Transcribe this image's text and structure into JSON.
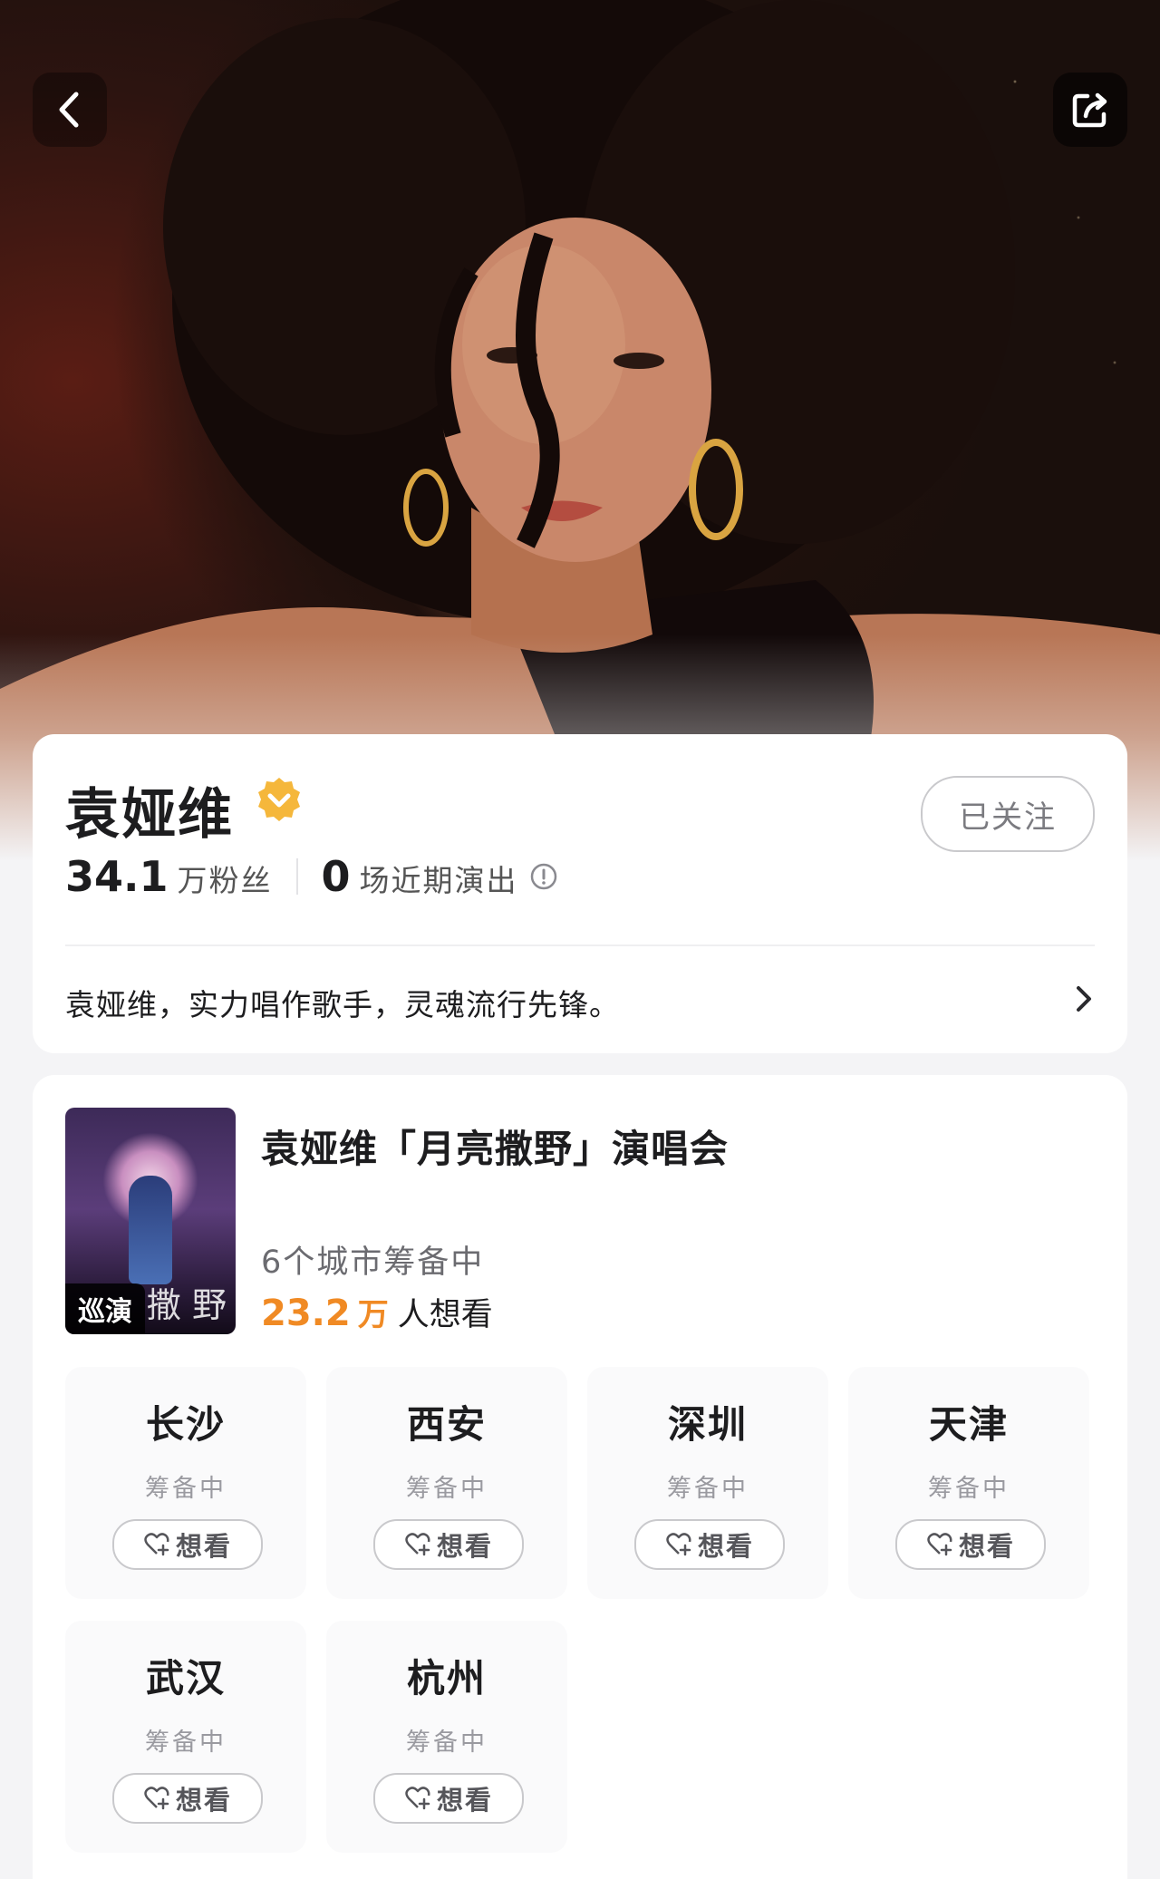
{
  "artist": {
    "name": "袁娅维",
    "followers_num": "34.1",
    "followers_label": "万粉丝",
    "shows_num": "0",
    "shows_label": "场近期演出",
    "follow_button": "已关注",
    "intro": "袁娅维，实力唱作歌手，灵魂流行先锋。"
  },
  "tour": {
    "poster_tag": "巡演",
    "poster_art_text": "撒 野",
    "title": "袁娅维「月亮撒野」演唱会",
    "status": "6个城市筹备中",
    "want_num": "23.2",
    "want_unit": "万",
    "want_label": "人想看",
    "cities": [
      {
        "name": "长沙",
        "status": "筹备中",
        "button": "想看"
      },
      {
        "name": "西安",
        "status": "筹备中",
        "button": "想看"
      },
      {
        "name": "深圳",
        "status": "筹备中",
        "button": "想看"
      },
      {
        "name": "天津",
        "status": "筹备中",
        "button": "想看"
      },
      {
        "name": "武汉",
        "status": "筹备中",
        "button": "想看"
      },
      {
        "name": "杭州",
        "status": "筹备中",
        "button": "想看"
      }
    ]
  },
  "icons": {
    "back": "chevron-left-icon",
    "share": "share-icon",
    "verified": "verified-badge-icon",
    "info": "info-icon",
    "chevron": "chevron-right-icon",
    "heart_plus": "heart-plus-icon"
  },
  "colors": {
    "accent": "#f08a24",
    "verified": "#f5b73b"
  }
}
